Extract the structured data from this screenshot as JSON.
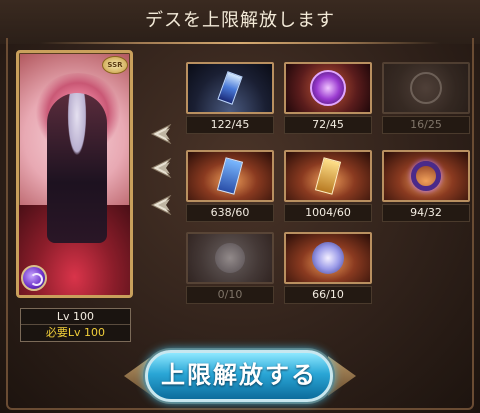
{
  "title": "デスを上限解放します",
  "character": {
    "rarity": "SSR",
    "level_label": "Lv 100",
    "required_level_label": "必要Lv 100",
    "element_icon": "dark-element-icon"
  },
  "materials": [
    {
      "name": "blue-crystal-icon",
      "count": "122/45",
      "available": true
    },
    {
      "name": "purple-sigil-orb-icon",
      "count": "72/45",
      "available": true
    },
    {
      "name": "faded-sigil-icon",
      "count": "16/25",
      "available": false
    },
    {
      "name": "blue-tablet-icon",
      "count": "638/60",
      "available": true
    },
    {
      "name": "gold-tablet-icon",
      "count": "1004/60",
      "available": true
    },
    {
      "name": "dark-ring-icon",
      "count": "94/32",
      "available": true
    },
    {
      "name": "faded-orb-icon",
      "count": "0/10",
      "available": false
    },
    {
      "name": "light-sphere-icon",
      "count": "66/10",
      "available": true
    }
  ],
  "uncap_button_label": "上限解放する"
}
